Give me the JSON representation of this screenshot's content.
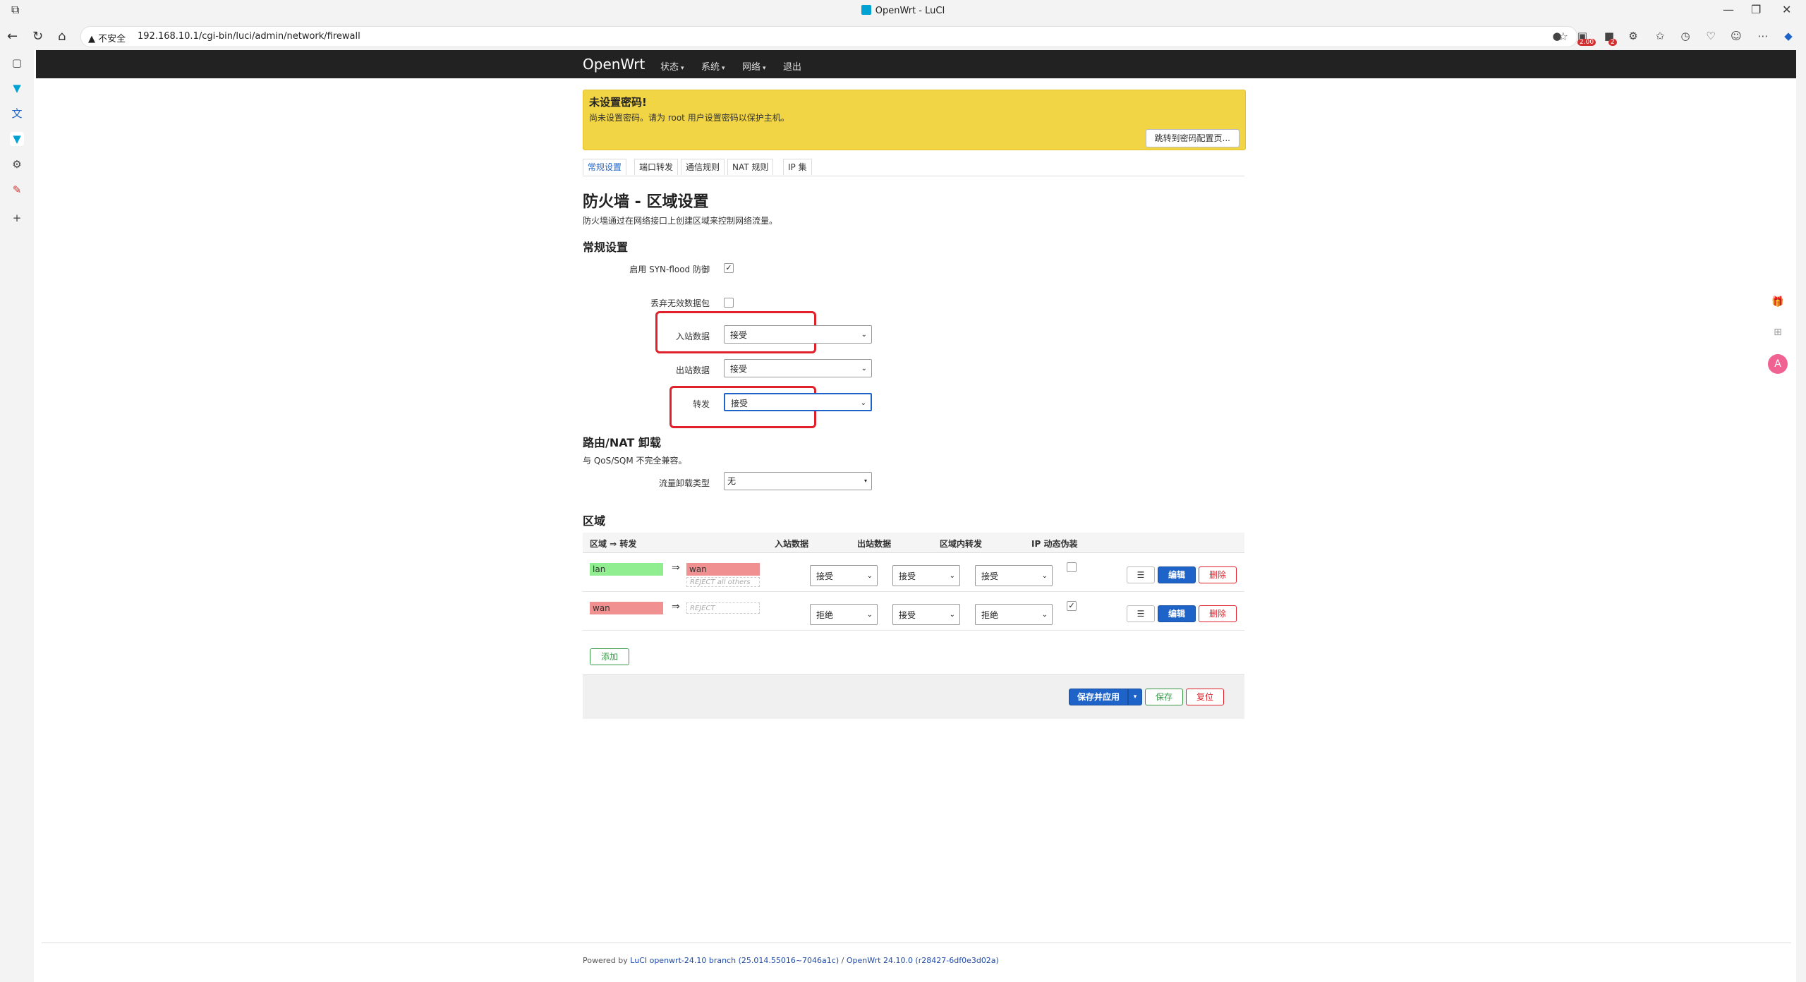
{
  "browser": {
    "window_title": "OpenWrt - LuCI",
    "security_label": "不安全",
    "url": "192.168.10.1/cgi-bin/luci/admin/network/firewall",
    "ext_badge_1": "2.00",
    "ext_badge_2": "2"
  },
  "nav": {
    "brand": "OpenWrt",
    "menu": [
      "状态",
      "系统",
      "网络",
      "退出"
    ]
  },
  "alert": {
    "title": "未设置密码!",
    "message": "尚未设置密码。请为 root 用户设置密码以保护主机。",
    "button": "跳转到密码配置页..."
  },
  "tabs": [
    "常规设置",
    "端口转发",
    "通信规则",
    "NAT 规则",
    "IP 集"
  ],
  "page": {
    "title": "防火墙 - 区域设置",
    "description": "防火墙通过在网络接口上创建区域来控制网络流量。"
  },
  "general": {
    "section_title": "常规设置",
    "syn_flood_label": "启用 SYN-flood 防御",
    "syn_flood_checked": true,
    "drop_invalid_label": "丢弃无效数据包",
    "drop_invalid_checked": false,
    "input_label": "入站数据",
    "input_value": "接受",
    "output_label": "出站数据",
    "output_value": "接受",
    "forward_label": "转发",
    "forward_value": "接受"
  },
  "offload": {
    "section_title": "路由/NAT 卸载",
    "description": "与 QoS/SQM 不完全兼容。",
    "type_label": "流量卸载类型",
    "type_value": "无"
  },
  "zones": {
    "section_title": "区域",
    "headers": [
      "区域 ⇒ 转发",
      "入站数据",
      "出站数据",
      "区域内转发",
      "IP 动态伪装"
    ],
    "rows": [
      {
        "zone": "lan",
        "zone_color": "#90ee90",
        "arrow": "⇒",
        "forward": "wan",
        "forward_color": "#f09090",
        "forward_sub": "REJECT all others",
        "input": "接受",
        "output": "接受",
        "intra": "接受",
        "masq": false
      },
      {
        "zone": "wan",
        "zone_color": "#f09090",
        "arrow": "⇒",
        "forward": "",
        "forward_color": "",
        "forward_sub": "REJECT",
        "input": "拒绝",
        "output": "接受",
        "intra": "拒绝",
        "masq": true
      }
    ],
    "menu_btn": "☰",
    "edit_btn": "编辑",
    "delete_btn": "删除",
    "add_btn": "添加"
  },
  "actions": {
    "save_apply": "保存并应用",
    "save": "保存",
    "reset": "复位"
  },
  "footer": {
    "powered_by": "Powered by",
    "luci_link": "LuCI openwrt-24.10 branch (25.014.55016~7046a1c)",
    "sep": "/",
    "openwrt_link": "OpenWrt 24.10.0 (r28427-6df0e3d02a)"
  },
  "colors": {
    "primary": "#1e64c8",
    "danger": "#e0202a",
    "alert_bg": "#f2d544",
    "nav_bg": "#222222"
  }
}
